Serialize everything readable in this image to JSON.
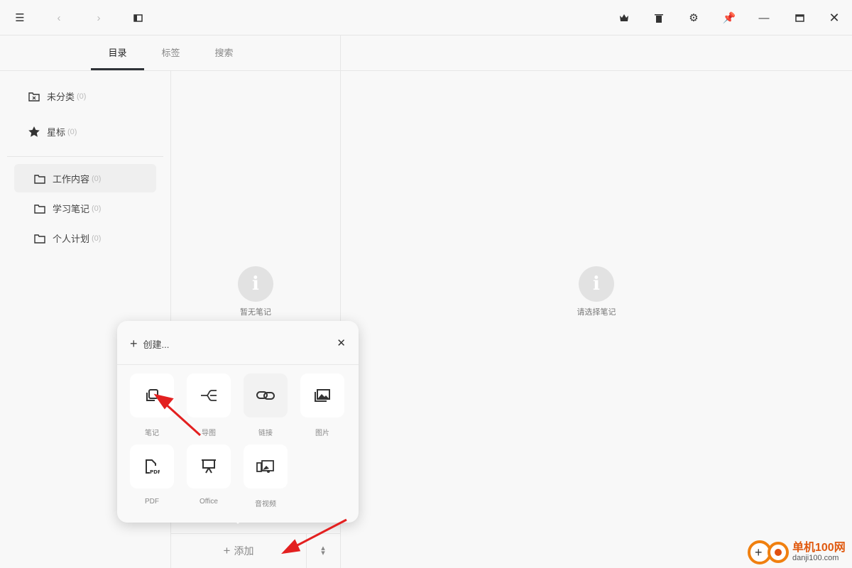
{
  "toolbar": {
    "icons": [
      "menu-icon",
      "back-icon",
      "forward-icon",
      "sidebar-toggle-icon",
      "crown-icon",
      "trash-icon",
      "gear-icon",
      "pin-icon",
      "minimize-icon",
      "maximize-icon",
      "close-icon"
    ]
  },
  "tabs": [
    {
      "label": "目录",
      "active": true
    },
    {
      "label": "标签"
    },
    {
      "label": "搜索"
    }
  ],
  "sidebar": {
    "special": [
      {
        "label": "未分类",
        "count": "(0)",
        "icon": "folder-x-icon"
      },
      {
        "label": "星标",
        "count": "(0)",
        "icon": "star-icon"
      }
    ],
    "folders": [
      {
        "label": "工作内容",
        "count": "(0)",
        "selected": true
      },
      {
        "label": "学习笔记",
        "count": "(0)"
      },
      {
        "label": "个人计划",
        "count": "(0)"
      }
    ]
  },
  "note_list": {
    "empty_text": "暂无笔记",
    "add_label": "添加"
  },
  "detail": {
    "empty_text": "请选择笔记"
  },
  "create_popup": {
    "title": "创建...",
    "items": [
      {
        "label": "笔记",
        "icon": "note-icon"
      },
      {
        "label": "导图",
        "icon": "mindmap-icon"
      },
      {
        "label": "链接",
        "icon": "link-icon"
      },
      {
        "label": "图片",
        "icon": "image-icon"
      },
      {
        "label": "PDF",
        "icon": "pdf-icon"
      },
      {
        "label": "Office",
        "icon": "presentation-icon"
      },
      {
        "label": "音视频",
        "icon": "media-icon"
      }
    ]
  },
  "watermark": {
    "text": "单机100网",
    "sub": "danji100.com"
  },
  "colors": {
    "annotation_arrow": "#e32020",
    "tab_indicator": "#2f3337"
  }
}
